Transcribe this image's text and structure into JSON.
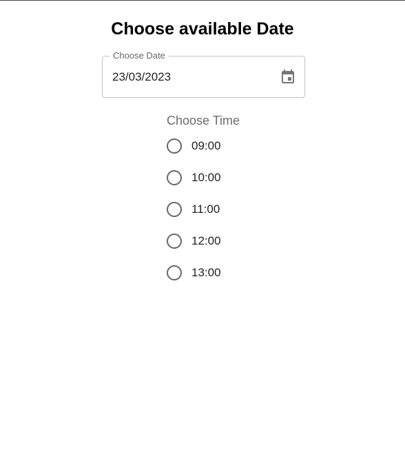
{
  "page": {
    "title": "Choose available Date"
  },
  "date_field": {
    "label": "Choose Date",
    "value": "23/03/2023",
    "icon": "calendar-icon"
  },
  "time_group": {
    "legend": "Choose Time",
    "options": [
      {
        "label": "09:00",
        "selected": false
      },
      {
        "label": "10:00",
        "selected": false
      },
      {
        "label": "11:00",
        "selected": false
      },
      {
        "label": "12:00",
        "selected": false
      },
      {
        "label": "13:00",
        "selected": false
      }
    ]
  },
  "colors": {
    "border": "#c4c4c4",
    "icon": "#757575",
    "muted_text": "#6b6b6b"
  }
}
